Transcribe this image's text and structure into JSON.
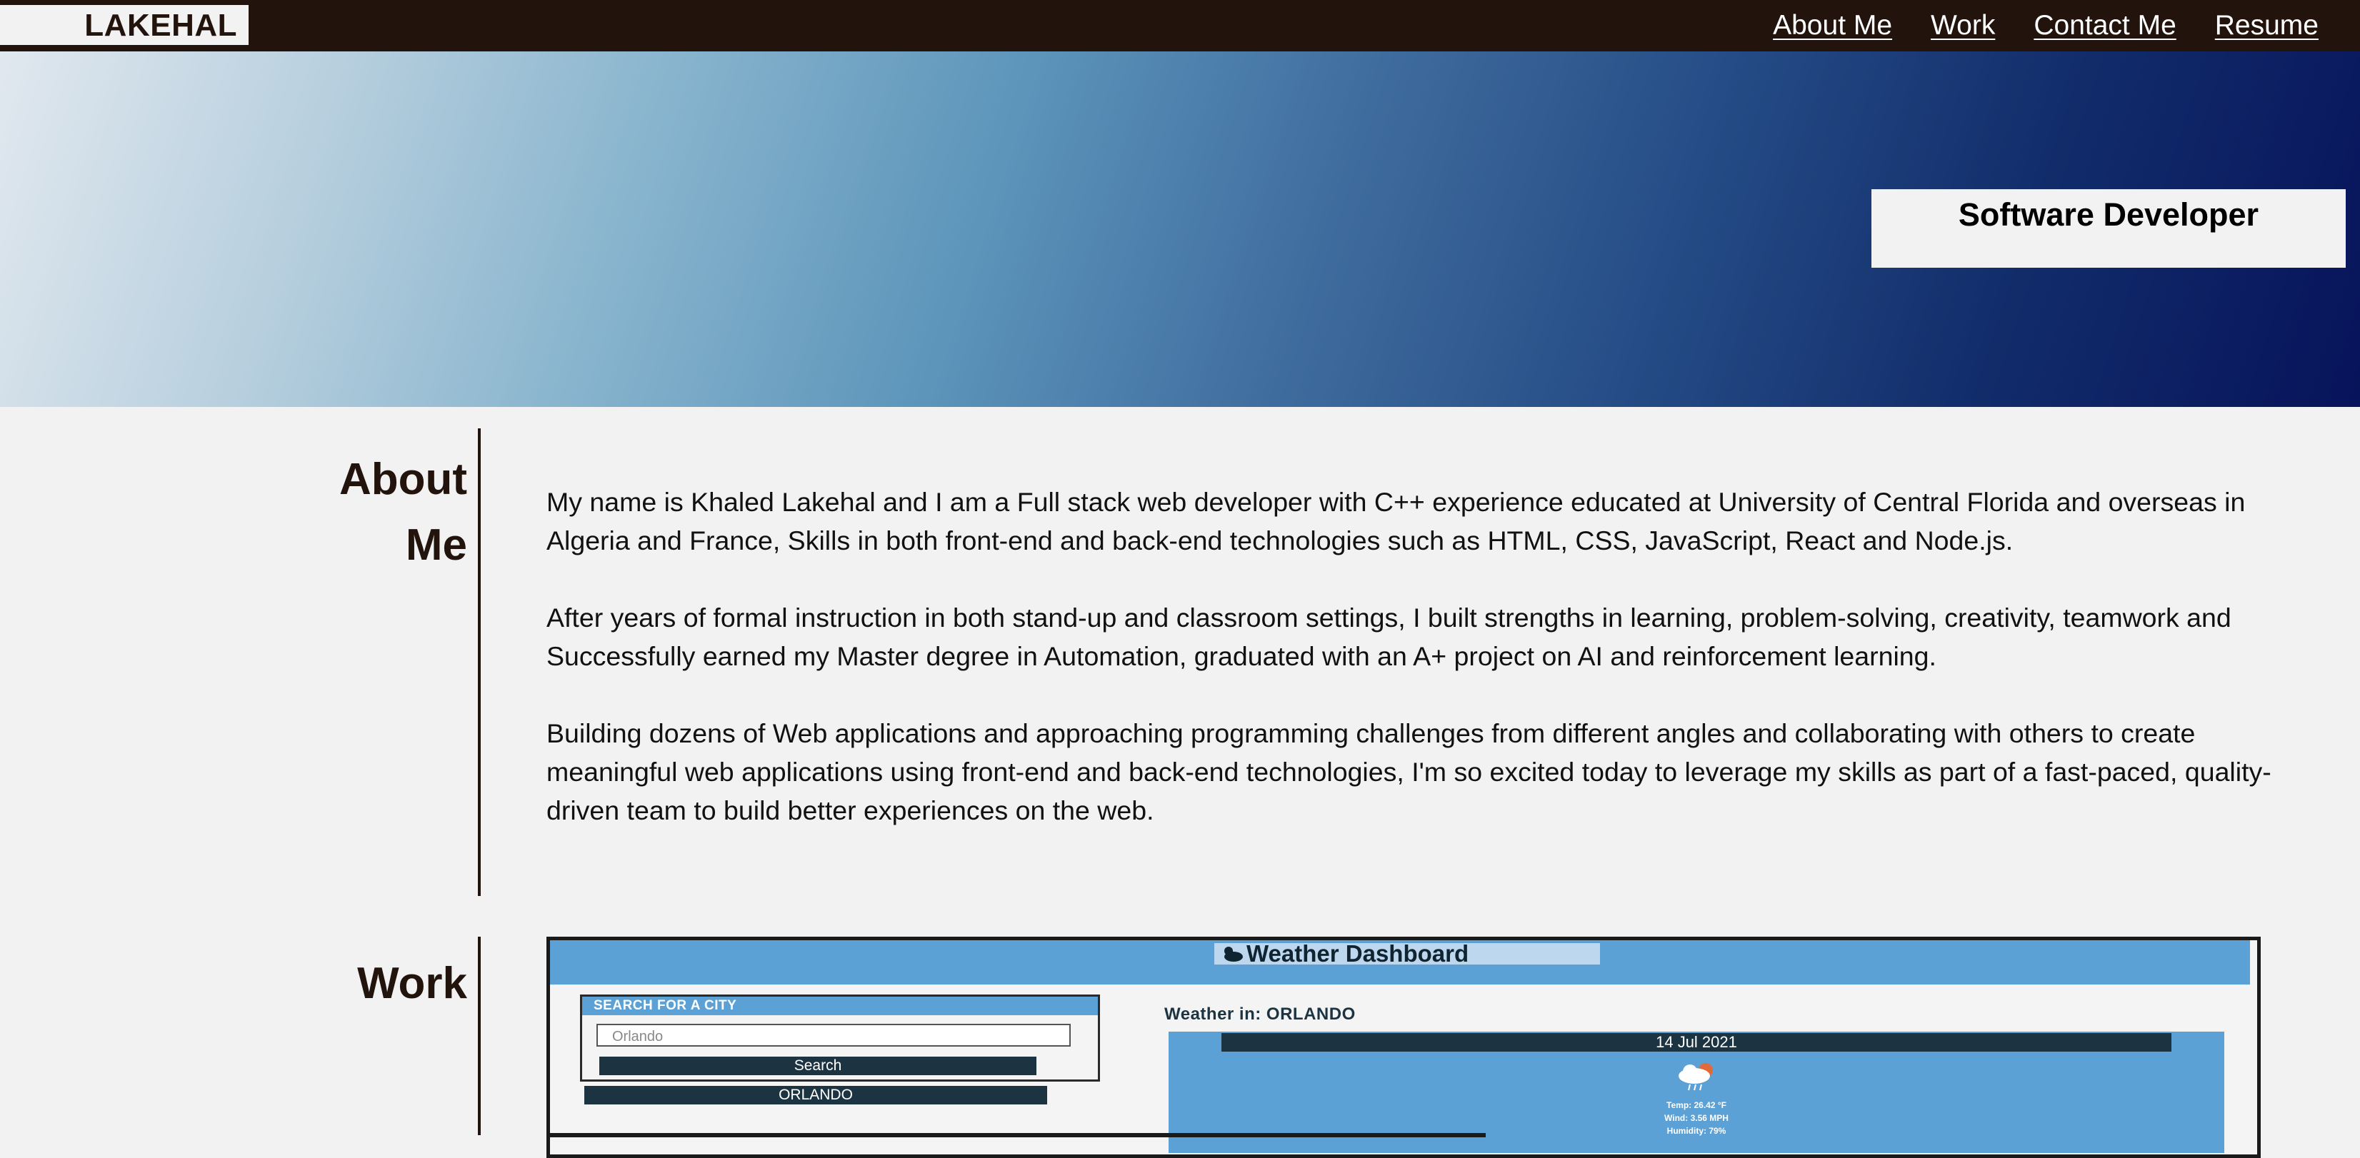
{
  "header": {
    "logo": "LAKEHAL",
    "nav": [
      {
        "label": "About Me"
      },
      {
        "label": "Work"
      },
      {
        "label": "Contact Me"
      },
      {
        "label": "Resume"
      }
    ]
  },
  "hero": {
    "title": "Software Developer"
  },
  "about": {
    "heading_line1": "About",
    "heading_line2": "Me",
    "paragraphs": [
      "My name is Khaled Lakehal and I am a Full stack web developer with C++ experience educated at University of Central Florida and overseas in Algeria and France, Skills in both front-end and back-end technologies such as HTML, CSS, JavaScript, React and Node.js.",
      "After years of formal instruction in both stand-up and classroom settings, I built strengths in learning, problem-solving, creativity, teamwork and Successfully earned my Master degree in Automation, graduated with an A+ project on AI and reinforcement learning.",
      "Building dozens of Web applications and approaching programming challenges from different angles and collaborating with others to create meaningful web applications using front-end and back-end technologies, I'm so excited today to leverage my skills as part of a fast-paced, quality-driven team to build better experiences on the web."
    ]
  },
  "work": {
    "heading": "Work",
    "project": {
      "title": "Weather Dashboard",
      "search_label": "SEARCH FOR A CITY",
      "search_value": "Orlando",
      "search_button": "Search",
      "history_item": "ORLANDO",
      "weather_in": "Weather in: ORLANDO",
      "date": "14 Jul 2021",
      "temp": "Temp: 26.42 °F",
      "wind": "Wind: 3.56 MPH",
      "humidity": "Humidity: 79%"
    }
  },
  "colors": {
    "nav_bg": "#22140d",
    "page_bg": "#f2f2f2",
    "accent_dark": "#22140d",
    "dashboard_blue": "#5ba1d6",
    "dashboard_navy": "#1c3442"
  }
}
